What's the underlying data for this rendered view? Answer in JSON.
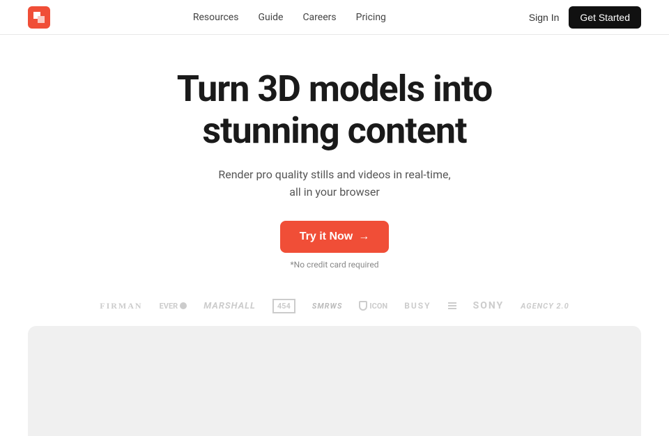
{
  "header": {
    "logo_alt": "Spline logo",
    "nav": {
      "resources": "Resources",
      "guide": "Guide",
      "careers": "Careers",
      "pricing": "Pricing"
    },
    "sign_in": "Sign In",
    "get_started": "Get Started"
  },
  "hero": {
    "title_line1": "Turn 3D models into",
    "title_line2": "stunning content",
    "subtitle_line1": "Render pro quality stills and videos in real-time,",
    "subtitle_line2": "all in your browser",
    "cta_button": "Try it Now",
    "cta_arrow": "→",
    "no_credit_card": "*No credit card required"
  },
  "brands": [
    {
      "name": "FIRMAN",
      "style": "firman"
    },
    {
      "name": "EVER1",
      "style": "ever"
    },
    {
      "name": "Marshall",
      "style": "marshall"
    },
    {
      "name": "454",
      "style": "box"
    },
    {
      "name": "SMRWS",
      "style": "text"
    },
    {
      "name": "ICON",
      "style": "icon"
    },
    {
      "name": "BUSY",
      "style": "busy"
    },
    {
      "name": "|||",
      "style": "bars"
    },
    {
      "name": "SONY",
      "style": "sony"
    },
    {
      "name": "Agency 2.0",
      "style": "agency"
    }
  ],
  "preview": {
    "alt": "Product preview area"
  }
}
